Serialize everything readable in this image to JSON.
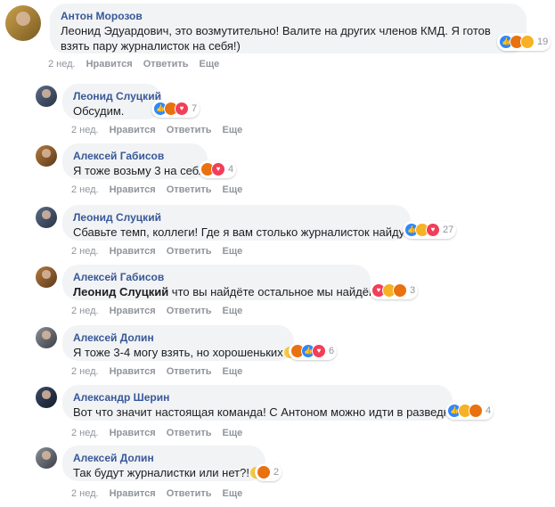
{
  "actions": {
    "time": "2 нед.",
    "like": "Нравится",
    "reply": "Ответить",
    "more": "Еще"
  },
  "comments": [
    {
      "author": "Антон Морозов",
      "lines": [
        "Леонид Эдуардович, это возмутительно! Валите на других членов КМД. Я готов",
        "взять пару журналисток на себя!)"
      ],
      "reaction_count": "19",
      "reaction_icons": [
        "like-icon",
        "angry-icon",
        "haha-icon"
      ]
    },
    {
      "author": "Леонид Слуцкий",
      "lines": [
        "Обсудим."
      ],
      "reaction_count": "7",
      "reaction_icons": [
        "like-icon",
        "angry-icon",
        "love-icon"
      ]
    },
    {
      "author": "Алексей Габисов",
      "lines": [
        "Я тоже возьму 3 на себя"
      ],
      "reaction_count": "4",
      "reaction_icons": [
        "angry-icon",
        "love-icon"
      ]
    },
    {
      "author": "Леонид Слуцкий",
      "lines": [
        "Сбавьте темп, коллеги! Где я вам столько журналисток найду?!"
      ],
      "reaction_count": "27",
      "reaction_icons": [
        "like-icon",
        "haha-icon",
        "love-icon"
      ]
    },
    {
      "author": "Алексей Габисов",
      "mention": "Леонид Слуцкий",
      "lines": [
        " что вы найдёте остальное мы найдём."
      ],
      "reaction_count": "3",
      "reaction_icons": [
        "love-icon",
        "haha-icon",
        "angry-icon"
      ]
    },
    {
      "author": "Алексей Долин",
      "lines": [
        "Я тоже 3-4 могу взять, но хорошеньких"
      ],
      "reaction_count": "6",
      "reaction_icons": [
        "angry-icon",
        "like-icon",
        "love-icon"
      ]
    },
    {
      "author": "Александр Шерин",
      "lines": [
        "Вот что значит настоящая команда! С Антоном можно идти в разведку!"
      ],
      "reaction_count": "4",
      "reaction_icons": [
        "like-icon",
        "haha-icon",
        "angry-icon"
      ]
    },
    {
      "author": "Алексей Долин",
      "lines": [
        "Так будут журналистки или нет?!"
      ],
      "reaction_count": "2",
      "reaction_icons": [
        "angry-icon"
      ]
    }
  ],
  "colors": {
    "author": "#385898",
    "bubble": "#f2f3f5",
    "meta": "#90949c"
  }
}
